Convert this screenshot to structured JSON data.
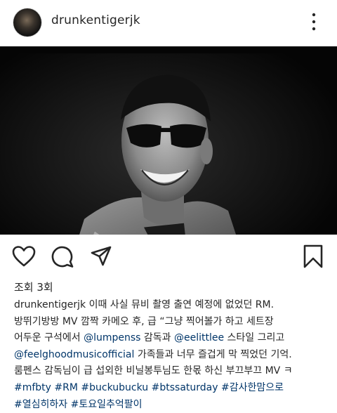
{
  "post": {
    "username": "drunkentigerjk",
    "view_count": "조회 3회"
  },
  "caption": {
    "author": "drunkentigerjk",
    "line1_text": " 이때 사실 뮤비 촬영 출연 예정에 없었던 RM.",
    "line2_text": "방뛰기방방 MV 깜짝 카메오 후, 급 “그냥 찍어볼가 하고 세트장",
    "line3_text_a": "어두운 구석에서 ",
    "line3_mention1": "@lumpenss",
    "line3_text_b": " 감독과 ",
    "line3_mention2": "@eelittlee",
    "line3_text_c": " 스타일 그리고",
    "line4_mention": "@feelghoodmusicofficial",
    "line4_text": " 가족들과 너무 즐겁게 막 찍었던 기억.",
    "line5_text": "룸펜스 감독님이 급 섭외한 비닐봉투님도 한몫 하신 부끄부끄 MV ㅋ",
    "hashtags_line6": [
      "#mfbty",
      "#RM",
      "#buckubucku",
      "#btssaturday",
      "#감사한맘으로"
    ],
    "hashtags_line7": [
      "#열심히하자",
      "#토요일추억팔이"
    ]
  },
  "icons": {
    "more": "more-vertical-icon",
    "like": "heart-icon",
    "comment": "comment-bubble-icon",
    "share": "send-paper-plane-icon",
    "save": "bookmark-icon"
  },
  "colors": {
    "text": "#262626",
    "link": "#003569",
    "media_bg": "#050505"
  }
}
